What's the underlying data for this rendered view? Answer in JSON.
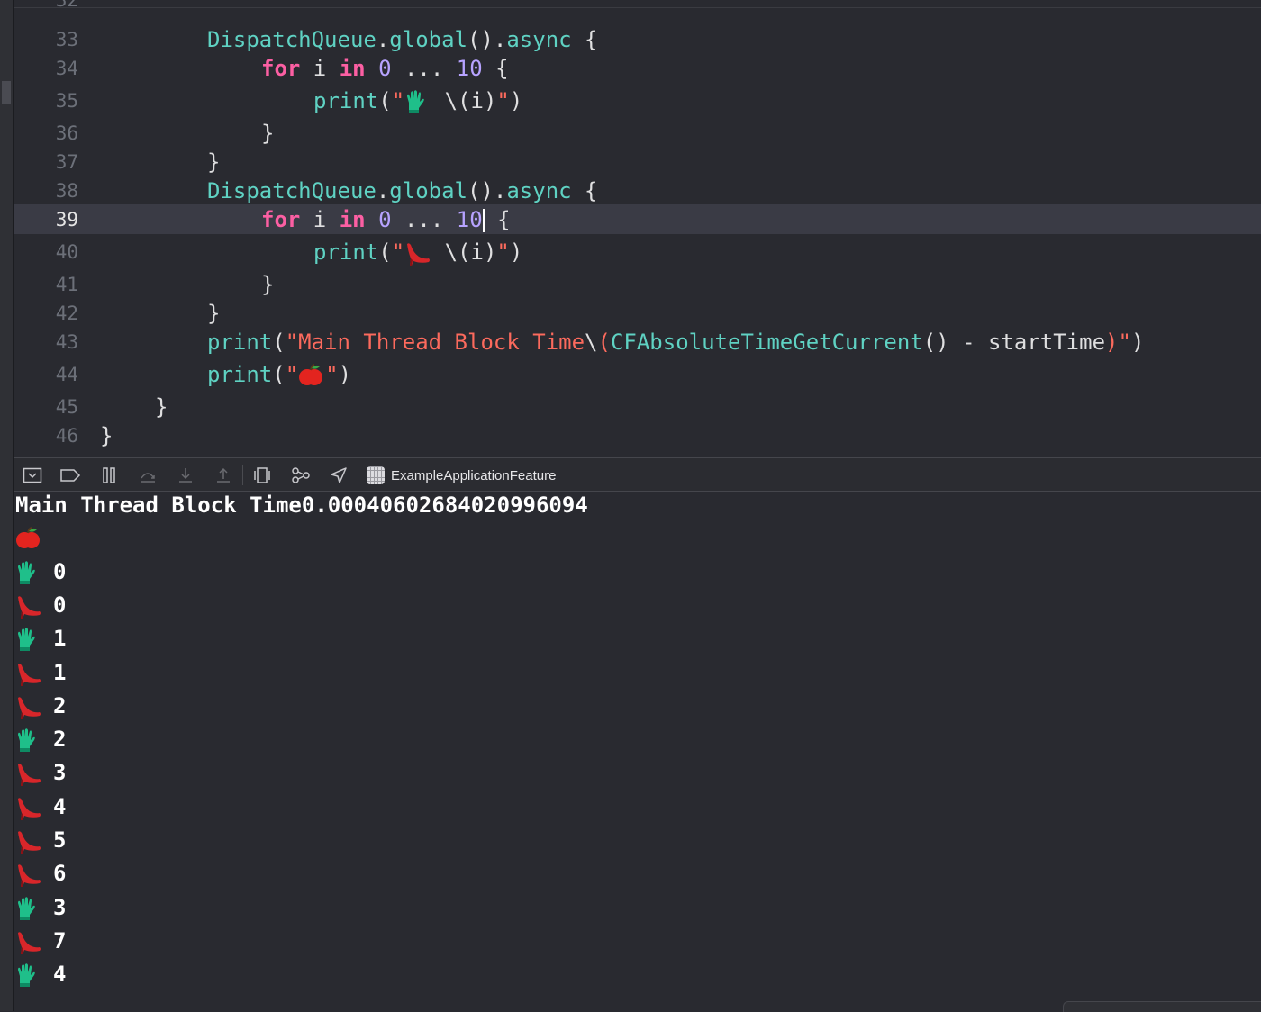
{
  "editor": {
    "lines": [
      {
        "n": "32",
        "code": ""
      },
      {
        "n": "33",
        "code": "DispatchQueue.global().async {"
      },
      {
        "n": "34",
        "code": "for i in 0 ... 10 {"
      },
      {
        "n": "35",
        "code": "print(\"🧤 \\(i)\")"
      },
      {
        "n": "36",
        "code": "}"
      },
      {
        "n": "37",
        "code": "}"
      },
      {
        "n": "38",
        "code": "DispatchQueue.global().async {"
      },
      {
        "n": "39",
        "code": "for i in 0 ... 10 {"
      },
      {
        "n": "40",
        "code": "print(\"👠 \\(i)\")"
      },
      {
        "n": "41",
        "code": "}"
      },
      {
        "n": "42",
        "code": "}"
      },
      {
        "n": "43",
        "code": "print(\"Main Thread Block Time\\(CFAbsoluteTimeGetCurrent() - startTime)\")"
      },
      {
        "n": "44",
        "code": "print(\"🍎\")"
      },
      {
        "n": "45",
        "code": "}"
      },
      {
        "n": "46",
        "code": "}"
      }
    ],
    "current_line": "39"
  },
  "toolbar": {
    "scheme_label": "ExampleApplicationFeature",
    "icons": [
      "hide-debug-area-icon",
      "breakpoints-toggle-icon",
      "pause-icon",
      "step-over-icon",
      "step-into-icon",
      "step-out-icon",
      "view-hierarchy-icon",
      "memory-graph-icon",
      "location-icon"
    ]
  },
  "console": {
    "lines": [
      {
        "emoji": "",
        "text": "Main Thread Block Time0.00040602684020996094"
      },
      {
        "emoji": "apple",
        "text": ""
      },
      {
        "emoji": "glove",
        "text": "0"
      },
      {
        "emoji": "heel",
        "text": "0"
      },
      {
        "emoji": "glove",
        "text": "1"
      },
      {
        "emoji": "heel",
        "text": "1"
      },
      {
        "emoji": "heel",
        "text": "2"
      },
      {
        "emoji": "glove",
        "text": "2"
      },
      {
        "emoji": "heel",
        "text": "3"
      },
      {
        "emoji": "heel",
        "text": "4"
      },
      {
        "emoji": "heel",
        "text": "5"
      },
      {
        "emoji": "heel",
        "text": "6"
      },
      {
        "emoji": "glove",
        "text": "3"
      },
      {
        "emoji": "heel",
        "text": "7"
      },
      {
        "emoji": "glove",
        "text": "4"
      }
    ]
  },
  "colors": {
    "background": "#292a30",
    "type": "#5fd2c3",
    "keyword": "#fc5fa3",
    "number": "#b7a3ff",
    "string": "#fc6a5d",
    "current_line": "#3a3b45"
  }
}
